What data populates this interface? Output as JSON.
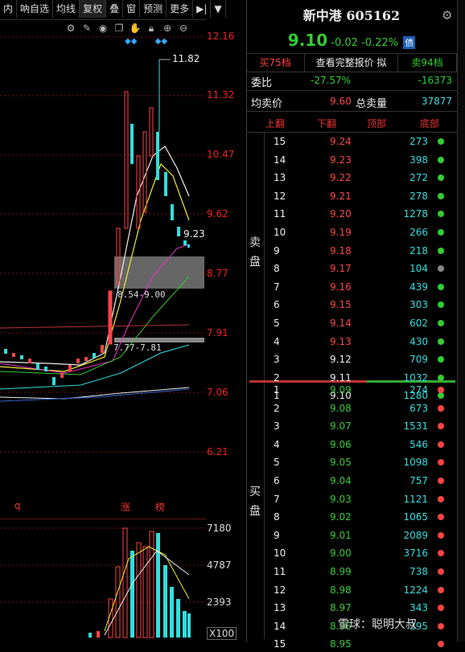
{
  "toolbar": {
    "tabs": [
      "内",
      "吶自选",
      "均线",
      "复权",
      "叠",
      "窗",
      "预测",
      "更多"
    ],
    "active_tab": "复权",
    "arrow": "▶|",
    "dropdown": "▼"
  },
  "chart_icons": [
    "gear-icon",
    "pen-icon",
    "eye-icon",
    "copy-icon",
    "hand-icon",
    "lock-icon",
    "zoom-in-icon",
    "zoom-out-icon"
  ],
  "price_axis": [
    "12.16",
    "11.32",
    "10.47",
    "9.62",
    "8.77",
    "7.91",
    "7.06",
    "6.21"
  ],
  "chart_annotations": {
    "high": "11.82",
    "last": "9.23",
    "zone_upper": "8.54-9.00",
    "zone_lower": "7.77-7.81",
    "marker_q": "q",
    "marker_zhang": "涨",
    "marker_bang": "榜"
  },
  "volume_axis": [
    "7180",
    "4787",
    "2393",
    "X100"
  ],
  "quote": {
    "name": "新中港",
    "code": "605162",
    "price": "9.10",
    "change": "-0.02",
    "change_pct": "-0.22%",
    "badge": "债"
  },
  "buttons": {
    "buy75": "买75档",
    "full_quote": "查看完整报价",
    "nav": "拟",
    "sell94": "卖94档"
  },
  "stats": {
    "weibi_label": "委比",
    "weibi_value": "-27.57%",
    "weicha_value": "-16373",
    "avg_label": "均卖价",
    "avg_value": "9.60",
    "total_label": "总卖量",
    "total_value": "37877"
  },
  "header": {
    "up": "上翻",
    "down": "下翻",
    "top": "顶部",
    "bottom": "底部"
  },
  "side_labels": {
    "sell": "卖盘",
    "buy": "买盘"
  },
  "sell_levels": [
    {
      "lvl": "15",
      "price": "9.24",
      "vol": "273"
    },
    {
      "lvl": "14",
      "price": "9.23",
      "vol": "398"
    },
    {
      "lvl": "13",
      "price": "9.22",
      "vol": "272"
    },
    {
      "lvl": "12",
      "price": "9.21",
      "vol": "278"
    },
    {
      "lvl": "11",
      "price": "9.20",
      "vol": "1278"
    },
    {
      "lvl": "10",
      "price": "9.19",
      "vol": "266"
    },
    {
      "lvl": "9",
      "price": "9.18",
      "vol": "218"
    },
    {
      "lvl": "8",
      "price": "9.17",
      "vol": "104"
    },
    {
      "lvl": "7",
      "price": "9.16",
      "vol": "439"
    },
    {
      "lvl": "6",
      "price": "9.15",
      "vol": "303"
    },
    {
      "lvl": "5",
      "price": "9.14",
      "vol": "602"
    },
    {
      "lvl": "4",
      "price": "9.13",
      "vol": "430"
    },
    {
      "lvl": "3",
      "price": "9.12",
      "vol": "709"
    },
    {
      "lvl": "2",
      "price": "9.11",
      "vol": "1032"
    },
    {
      "lvl": "1",
      "price": "9.10",
      "vol": "1280"
    }
  ],
  "buy_levels": [
    {
      "lvl": "1",
      "price": "9.09",
      "vol": "274"
    },
    {
      "lvl": "2",
      "price": "9.08",
      "vol": "673"
    },
    {
      "lvl": "3",
      "price": "9.07",
      "vol": "1531"
    },
    {
      "lvl": "4",
      "price": "9.06",
      "vol": "546"
    },
    {
      "lvl": "5",
      "price": "9.05",
      "vol": "1098"
    },
    {
      "lvl": "6",
      "price": "9.04",
      "vol": "757"
    },
    {
      "lvl": "7",
      "price": "9.03",
      "vol": "1121"
    },
    {
      "lvl": "8",
      "price": "9.02",
      "vol": "1065"
    },
    {
      "lvl": "9",
      "price": "9.01",
      "vol": "2089"
    },
    {
      "lvl": "10",
      "price": "9.00",
      "vol": "3716"
    },
    {
      "lvl": "11",
      "price": "8.99",
      "vol": "738"
    },
    {
      "lvl": "12",
      "price": "8.98",
      "vol": "1224"
    },
    {
      "lvl": "13",
      "price": "8.97",
      "vol": "343"
    },
    {
      "lvl": "14",
      "price": "8.96",
      "vol": "395"
    },
    {
      "lvl": "15",
      "price": "8.95",
      "vol": ""
    }
  ],
  "sell_dot_colors": [
    "#3c3",
    "#3c3",
    "#3c3",
    "#3c3",
    "#3c3",
    "#3c3",
    "#3c3",
    "#888",
    "#3c3",
    "#3c3",
    "#3c3",
    "#3c3",
    "#3c3",
    "#3c3",
    "#3c3"
  ],
  "buy_dot_color": "#f44",
  "watermark": "雪球：聪明大叔"
}
